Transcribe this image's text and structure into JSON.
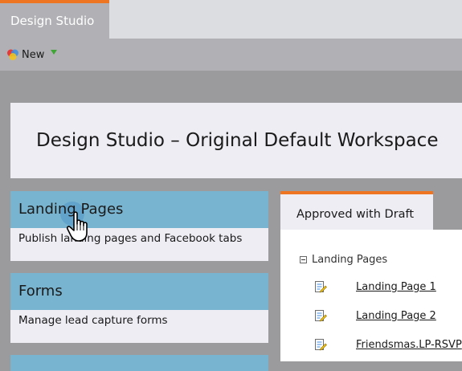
{
  "app": {
    "active_tab": "Design Studio"
  },
  "toolbar": {
    "new_label": "New"
  },
  "header": {
    "title": "Design Studio – Original Default Workspace"
  },
  "cards": [
    {
      "title": "Landing Pages",
      "description": "Publish landing pages and Facebook tabs"
    },
    {
      "title": "Forms",
      "description": "Manage lead capture forms"
    }
  ],
  "right_panel": {
    "tab_label": "Approved with Draft",
    "tree_root": "Landing Pages",
    "items": [
      "Landing Page 1",
      "Landing Page 2",
      "Friendsmas.LP-RSVP"
    ]
  },
  "colors": {
    "accent": "#ee7623",
    "card_header": "#78b4d0",
    "background": "#9b9b9e"
  },
  "icons": [
    "color-wheel-icon",
    "dropdown-arrow-icon",
    "hand-pointer-icon",
    "minus-box-icon",
    "page-edit-icon"
  ]
}
